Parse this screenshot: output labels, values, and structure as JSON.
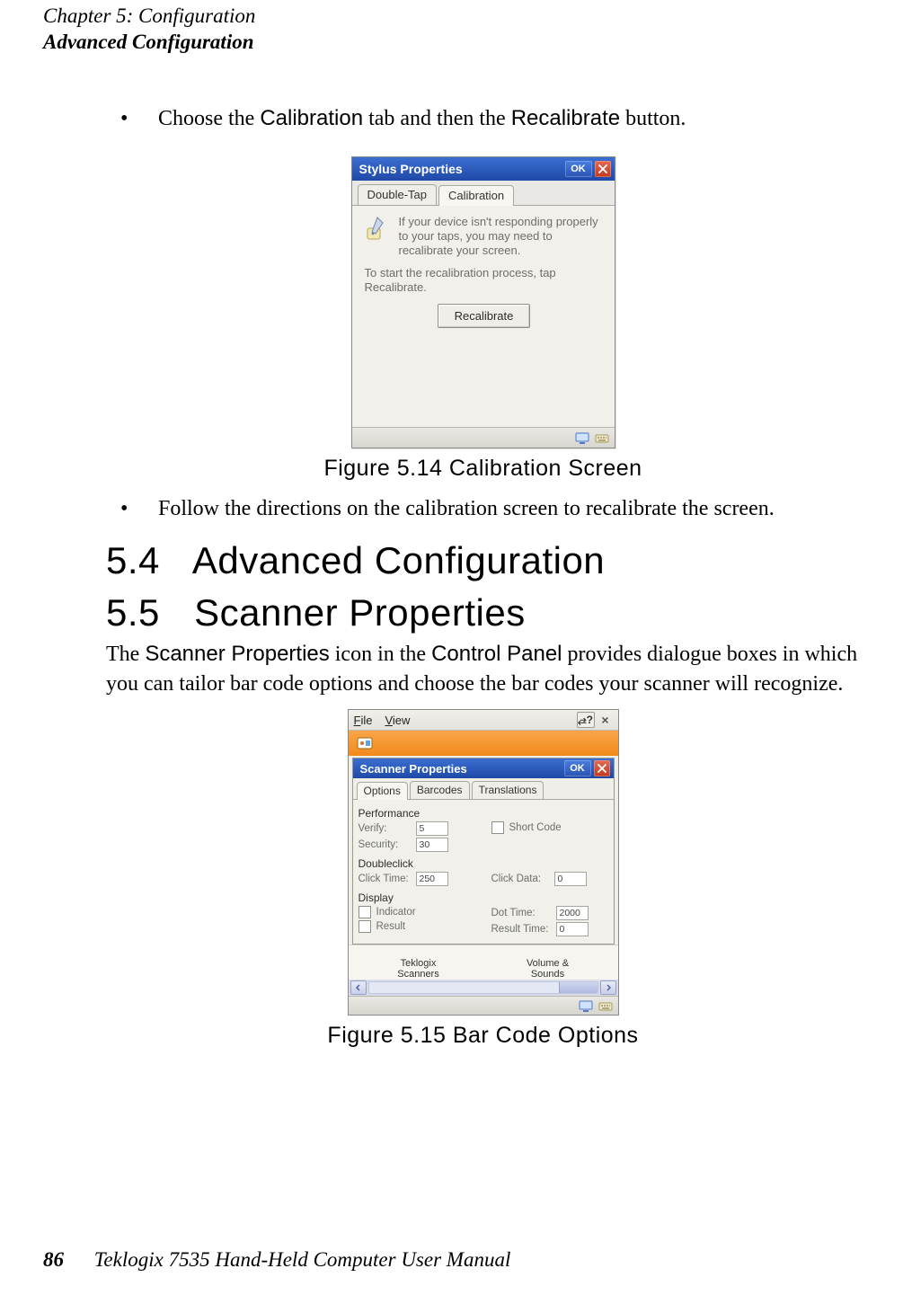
{
  "header": {
    "chapter_line": "Chapter 5: Configuration",
    "section_line": "Advanced Configuration"
  },
  "bullets": {
    "b1_pre": "Choose the ",
    "b1_calibration": "Calibration",
    "b1_mid": " tab and then the ",
    "b1_recalibrate": "Recalibrate",
    "b1_post": " button.",
    "b2": "Follow the directions on the calibration screen to recalibrate the screen."
  },
  "fig1": {
    "title": "Stylus Properties",
    "ok": "OK",
    "tab_doubletap": "Double-Tap",
    "tab_calibration": "Calibration",
    "hint1": "If your device isn't responding properly to your taps, you may need to recalibrate your screen.",
    "hint2": "To start the recalibration process, tap Recalibrate.",
    "button": "Recalibrate",
    "caption": "Figure 5.14 Calibration Screen"
  },
  "sections": {
    "s54_num": "5.4",
    "s54_title": "Advanced Configuration",
    "s55_num": "5.5",
    "s55_title": "Scanner Properties"
  },
  "para55": {
    "pre": "The ",
    "sp": "Scanner Properties",
    "mid": " icon in the ",
    "cp": "Control Panel",
    "post": " provides dialogue boxes in which you can tailor bar code options and choose the bar codes your scanner will recognize."
  },
  "fig2": {
    "menu_file": "File",
    "menu_view": "View",
    "help": "?",
    "close": "×",
    "title": "Scanner Properties",
    "ok": "OK",
    "tab_options": "Options",
    "tab_barcodes": "Barcodes",
    "tab_translations": "Translations",
    "grp_performance": "Performance",
    "lbl_verify": "Verify:",
    "val_verify": "5",
    "lbl_security": "Security:",
    "val_security": "30",
    "chk_shortcode": "Short Code",
    "grp_doubleclick": "Doubleclick",
    "lbl_clicktime": "Click Time:",
    "val_clicktime": "250",
    "lbl_clickdata": "Click Data:",
    "val_clickdata": "0",
    "grp_display": "Display",
    "chk_indicator": "Indicator",
    "chk_result": "Result",
    "lbl_dottime": "Dot Time:",
    "val_dottime": "2000",
    "lbl_resulttime": "Result Time:",
    "val_resulttime": "0",
    "cp_item1a": "Teklogix",
    "cp_item1b": "Scanners",
    "cp_item2a": "Volume &",
    "cp_item2b": "Sounds",
    "caption": "Figure 5.15 Bar Code Options"
  },
  "footer": {
    "page": "86",
    "manual": "Teklogix 7535 Hand-Held Computer User Manual"
  }
}
